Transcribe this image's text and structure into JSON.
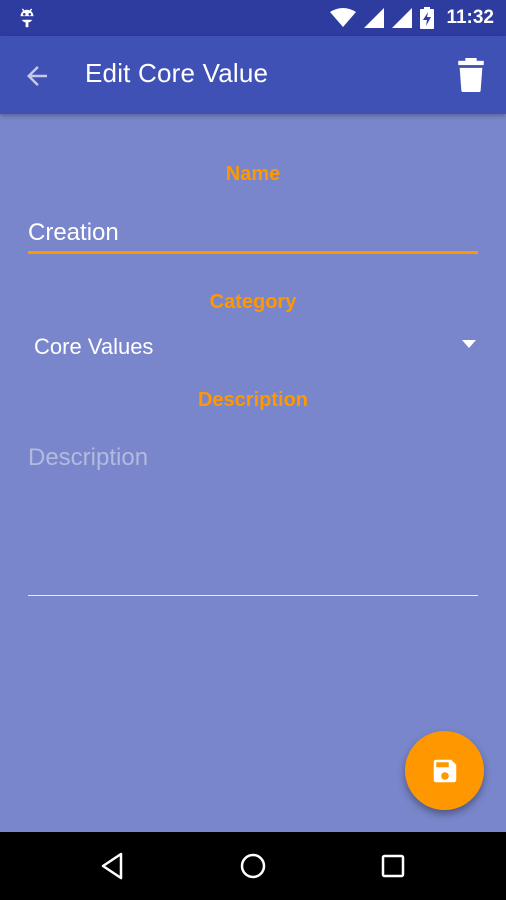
{
  "status_bar": {
    "time": "11:32",
    "icons": [
      "android-icon",
      "wifi-icon",
      "signal-icon",
      "signal-icon",
      "battery-charging-icon"
    ]
  },
  "app_bar": {
    "title": "Edit Core Value",
    "back_icon": "arrow-back-icon",
    "delete_icon": "trash-icon"
  },
  "form": {
    "name_label": "Name",
    "name_value": "Creation",
    "category_label": "Category",
    "category_value": "Core Values",
    "description_label": "Description",
    "description_value": "",
    "description_placeholder": "Description"
  },
  "fab": {
    "icon": "save-icon"
  },
  "nav_bar": {
    "icons": [
      "nav-back-icon",
      "nav-home-icon",
      "nav-recents-icon"
    ]
  },
  "colors": {
    "status_bar": "#2d3c9e",
    "app_bar": "#3f51b5",
    "background": "#7986cb",
    "accent": "#ff9800",
    "text": "#ffffff"
  }
}
